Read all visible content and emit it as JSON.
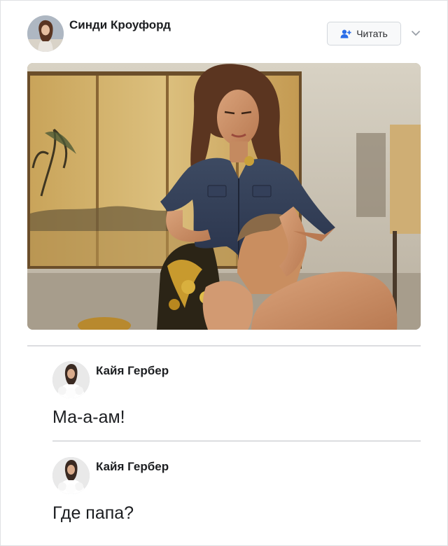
{
  "post": {
    "author_name": "Синди Кроуфорд",
    "follow_label": "Читать",
    "photo": {
      "icon": "photo-woman-denim-shirt-and-shirtless-man"
    }
  },
  "comments": [
    {
      "author": "Кайя Гербер",
      "text": "Ма-а-ам!"
    },
    {
      "author": "Кайя Гербер",
      "text": "Где папа?"
    }
  ],
  "colors": {
    "accent": "#2a6de8",
    "divider": "#dcdde0",
    "text": "#1c1e21"
  }
}
